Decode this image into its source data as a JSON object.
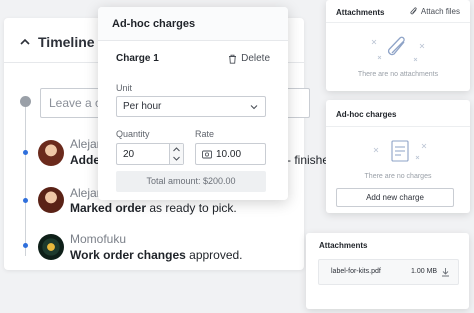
{
  "timeline": {
    "title": "Timeline",
    "comment_placeholder": "Leave a co",
    "entries": [
      {
        "name": "Alejan",
        "action_bold": "Adde",
        "action_rest": ""
      },
      {
        "name": "Alejan",
        "action_bold": "Marked order",
        "action_rest": " as ready to pick."
      },
      {
        "name": "Momofuku",
        "action_bold": "Work order changes",
        "action_rest": " approved."
      }
    ],
    "overflow_text": "finishe"
  },
  "popover": {
    "title": "Ad-hoc charges",
    "charge_title": "Charge 1",
    "delete_label": "Delete",
    "unit_label": "Unit",
    "unit_value": "Per hour",
    "quantity_label": "Quantity",
    "quantity_value": "20",
    "rate_label": "Rate",
    "rate_value": "10.00",
    "total": "Total amount: $200.00"
  },
  "attachments_card": {
    "title": "Attachments",
    "attach_label": "Attach files",
    "empty": "There are no attachments"
  },
  "adhoc_card": {
    "title": "Ad-hoc charges",
    "empty": "There are no charges",
    "add_label": "Add new charge"
  },
  "attachments_card2": {
    "title": "Attachments",
    "file_name": "label-for-kits.pdf",
    "file_size": "1.00 MB"
  },
  "colors": {
    "accent": "#2f6fdc",
    "border": "#c9cdd3",
    "muted": "#9aa0a8"
  }
}
